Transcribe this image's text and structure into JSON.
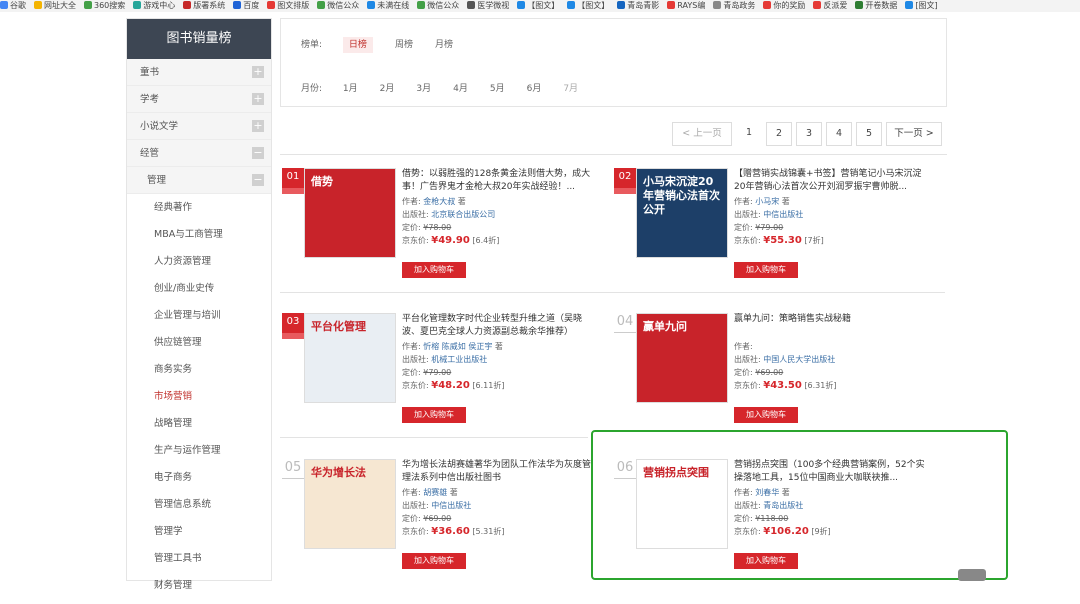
{
  "bookmarks": [
    {
      "label": "谷歌",
      "color": "#4285f4"
    },
    {
      "label": "网址大全",
      "color": "#f4b400"
    },
    {
      "label": "360搜索",
      "color": "#43a047"
    },
    {
      "label": "游戏中心",
      "color": "#26a69a"
    },
    {
      "label": "版署系统",
      "color": "#c62828"
    },
    {
      "label": "百度",
      "color": "#1e63d6"
    },
    {
      "label": "图文排版",
      "color": "#e53935"
    },
    {
      "label": "微信公众",
      "color": "#43a047"
    },
    {
      "label": "未满在线",
      "color": "#1e88e5"
    },
    {
      "label": "微信公众",
      "color": "#43a047"
    },
    {
      "label": "医学微视",
      "color": "#555555"
    },
    {
      "label": "【图文】",
      "color": "#1e88e5"
    },
    {
      "label": "【图文】",
      "color": "#1e88e5"
    },
    {
      "label": "青岛青影",
      "color": "#1565c0"
    },
    {
      "label": "RAYS编",
      "color": "#e53935"
    },
    {
      "label": "青岛政务",
      "color": "#888888"
    },
    {
      "label": "你的奖励",
      "color": "#e53935"
    },
    {
      "label": "反派爱",
      "color": "#e53935"
    },
    {
      "label": "开卷数据",
      "color": "#2e7d32"
    },
    {
      "label": "[图文]",
      "color": "#1e88e5"
    }
  ],
  "sidebar": {
    "title": "图书销量榜",
    "categories": [
      {
        "label": "童书",
        "toggle": "+"
      },
      {
        "label": "学考",
        "toggle": "+"
      },
      {
        "label": "小说文学",
        "toggle": "+"
      },
      {
        "label": "经管",
        "toggle": "−"
      }
    ],
    "subcategory": {
      "label": "管理",
      "toggle": "−"
    },
    "leaves": [
      "经典著作",
      "MBA与工商管理",
      "人力资源管理",
      "创业/商业史传",
      "企业管理与培训",
      "供应链管理",
      "商务实务",
      "市场营销",
      "战略管理",
      "生产与运作管理",
      "电子商务",
      "管理信息系统",
      "管理学",
      "管理工具书",
      "财务管理"
    ],
    "active_leaf": "市场营销"
  },
  "filter": {
    "ranking_label": "榜单:",
    "ranking_options": [
      "日榜",
      "周榜",
      "月榜"
    ],
    "ranking_active": "日榜",
    "month_label": "月份:",
    "months": [
      "1月",
      "2月",
      "3月",
      "4月",
      "5月",
      "6月",
      "7月"
    ],
    "month_disabled": "7月"
  },
  "pager": {
    "prev": "< 上一页",
    "pages": [
      "1",
      "2",
      "3",
      "4",
      "5"
    ],
    "current": "1",
    "next": "下一页 >"
  },
  "labels": {
    "author": "作者:",
    "publisher": "出版社:",
    "list_price": "定价:",
    "jd_price": "京东价:",
    "add_to_cart": "加入购物车"
  },
  "books": [
    {
      "rank": "01",
      "title": "借势：以弱胜强的128条黄金法则借大势，成大事！广告界鬼才金枪大叔20年实战经验！...",
      "author": "金枪大叔",
      "author_suffix": "著",
      "publisher": "北京联合出版公司",
      "list_price": "¥78.00",
      "jd_price": "¥49.90",
      "discount": "[6.4折]",
      "cover_color": "#c8232a",
      "cover_text": "借势"
    },
    {
      "rank": "02",
      "title": "【赠营销实战锦囊+书签】营销笔记小马宋沉淀20年营销心法首次公开刘润罗振宇曹帅脱...",
      "author": "小马宋",
      "author_suffix": "著",
      "publisher": "中信出版社",
      "list_price": "¥79.00",
      "jd_price": "¥55.30",
      "discount": "[7折]",
      "cover_color": "#1d3f68",
      "cover_text": "小马宋沉淀20年营销心法首次公开"
    },
    {
      "rank": "03",
      "title": "平台化管理数字时代企业转型升维之道（吴晓波、夏巴克全球人力资源副总裁余华推荐）",
      "author": "忻榕 陈威如 侯正宇",
      "author_suffix": "著",
      "publisher": "机械工业出版社",
      "list_price": "¥79.00",
      "jd_price": "¥48.20",
      "discount": "[6.11折]",
      "cover_color": "#e9eef3",
      "cover_text": "平台化管理"
    },
    {
      "rank": "04",
      "title": "赢单九问：策略销售实战秘籍",
      "author": "",
      "author_suffix": "",
      "publisher": "中国人民大学出版社",
      "list_price": "¥69.00",
      "jd_price": "¥43.50",
      "discount": "[6.31折]",
      "cover_color": "#c8232a",
      "cover_text": "赢单九问"
    },
    {
      "rank": "05",
      "title": "华为增长法胡赛雄著华为团队工作法华为灰度管理法系列中信出版社图书",
      "author": "胡赛雄",
      "author_suffix": "著",
      "publisher": "中信出版社",
      "list_price": "¥69.00",
      "jd_price": "¥36.60",
      "discount": "[5.31折]",
      "cover_color": "#f6e7d2",
      "cover_text": "华为增长法"
    },
    {
      "rank": "06",
      "title": "营销拐点突围（100多个经典营销案例，52个实操落地工具，15位中国商业大咖联袂推...",
      "author": "刘春华",
      "author_suffix": "著",
      "publisher": "青岛出版社",
      "list_price": "¥118.00",
      "jd_price": "¥106.20",
      "discount": "[9折]",
      "cover_color": "#ffffff",
      "cover_text": "营销拐点突围"
    }
  ],
  "colors": {
    "accent_red": "#d6262b",
    "sidebar_header": "#3d4653",
    "highlight_green": "#2ba52e"
  }
}
